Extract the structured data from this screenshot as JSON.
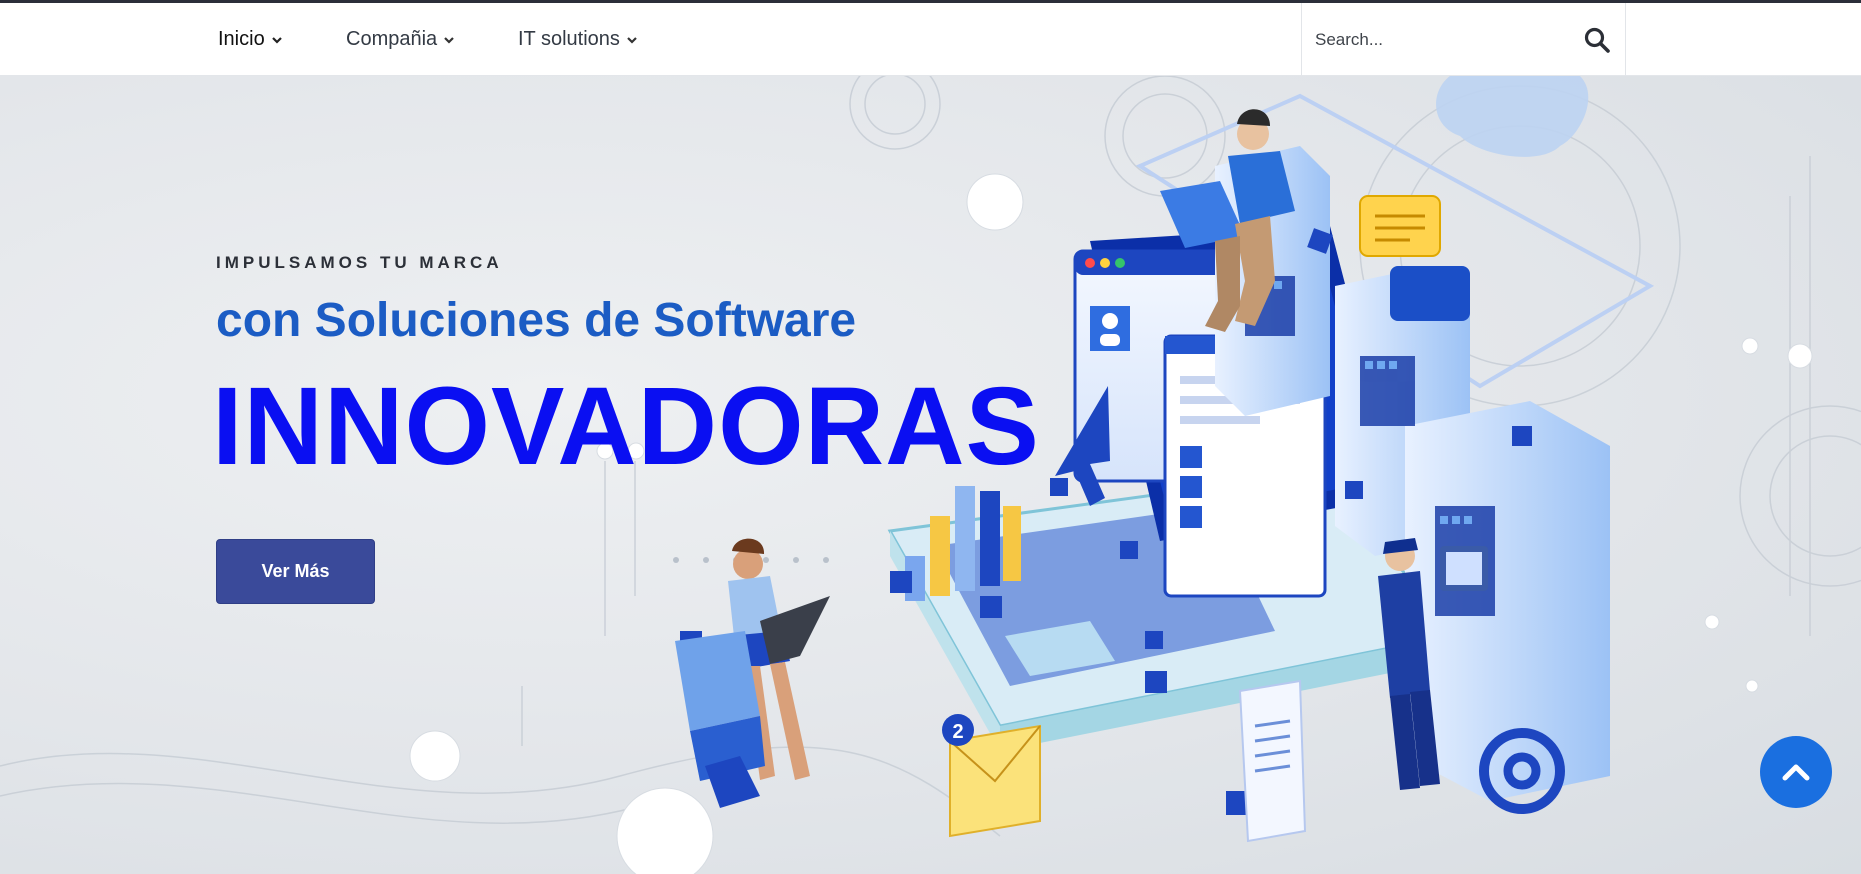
{
  "nav": {
    "items": [
      {
        "label": "Inicio",
        "active": true
      },
      {
        "label": "Compañia",
        "active": false
      },
      {
        "label": "IT solutions",
        "active": false
      }
    ],
    "search_placeholder": "Search..."
  },
  "hero": {
    "eyebrow": "IMPULSAMOS TU MARCA",
    "subtitle": "con Soluciones de Software",
    "title": "INNOVADORAS",
    "cta_label": "Ver Más",
    "badge_count": "2"
  },
  "icons": {
    "dropdown": "chevron-down-icon",
    "search": "search-icon",
    "scroll_top": "chevron-up-icon"
  },
  "colors": {
    "subtitle": "#1b5cc4",
    "title": "#0a0ff2",
    "cta": "#3a4a9a",
    "scroll_top": "#1a6fe0"
  }
}
